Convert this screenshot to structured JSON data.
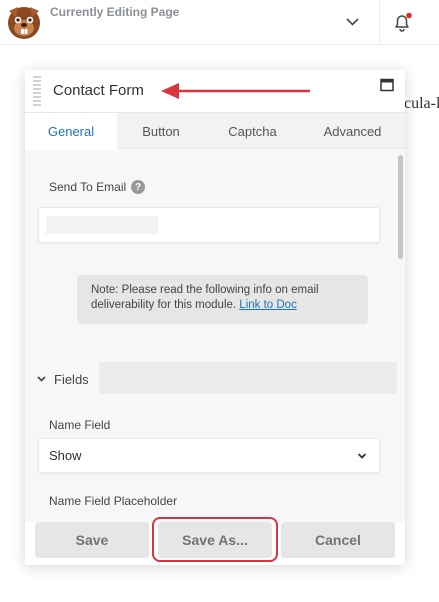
{
  "topbar": {
    "title": "Currently Editing Page"
  },
  "background": {
    "visible_text": "cula-l"
  },
  "panel": {
    "title": "Contact Form",
    "tabs": [
      {
        "label": "General",
        "active": true
      },
      {
        "label": "Button",
        "active": false
      },
      {
        "label": "Captcha",
        "active": false
      },
      {
        "label": "Advanced",
        "active": false
      }
    ],
    "send_to_email": {
      "label": "Send To Email",
      "help": "?",
      "value": ""
    },
    "note": {
      "text": "Note: Please read the following info on email deliverability for this module.",
      "link": "Link to Doc"
    },
    "fields_section": {
      "label": "Fields"
    },
    "name_field": {
      "label": "Name Field",
      "value": "Show"
    },
    "name_placeholder": {
      "label": "Name Field Placeholder"
    },
    "footer": {
      "save": "Save",
      "save_as": "Save As...",
      "cancel": "Cancel"
    }
  },
  "colors": {
    "accent": "#1b75ba",
    "annotation": "#d9343f",
    "notification_dot": "#e02a2a"
  },
  "icons": [
    "beaver-logo-icon",
    "chevron-down-icon",
    "bell-icon",
    "maximize-icon",
    "drag-handle-icon",
    "help-icon",
    "caret-down-icon"
  ]
}
